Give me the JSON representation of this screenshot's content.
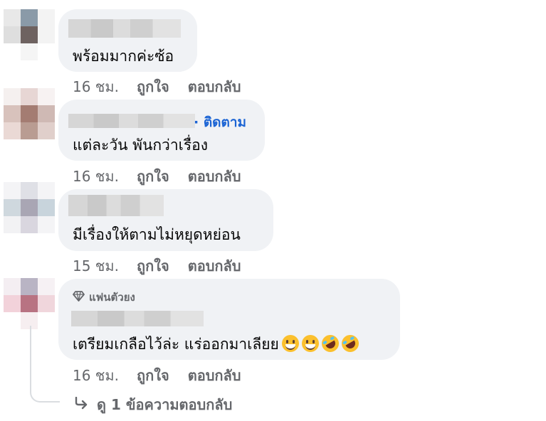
{
  "comments": [
    {
      "text": "พร้อมมากค่ะซ้อ",
      "time": "16 ชม.",
      "like_label": "ถูกใจ",
      "reply_label": "ตอบกลับ"
    },
    {
      "follow_label": "· ติดตาม",
      "text": "แต่ละวัน พันกว่าเรื่อง",
      "time": "16 ชม.",
      "like_label": "ถูกใจ",
      "reply_label": "ตอบกลับ"
    },
    {
      "text": "มีเรื่องให้ตามไม่หยุดหย่อน",
      "time": "15 ชม.",
      "like_label": "ถูกใจ",
      "reply_label": "ตอบกลับ"
    },
    {
      "badge_label": "แฟนตัวยง",
      "text": "เตรียมเกลือไว้ล่ะ แร่ออกมาเลียย",
      "time": "16 ชม.",
      "like_label": "ถูกใจ",
      "reply_label": "ตอบกลับ"
    }
  ],
  "view_replies": {
    "label": "ดู 1 ข้อความตอบกลับ"
  },
  "colors": {
    "bubble": "#f0f2f5",
    "meta_text": "#65676b",
    "follow_link": "#1b64d4"
  },
  "icons": [
    "diamond-icon",
    "reply-arrow-icon",
    "grinning-face-emoji",
    "rofl-emoji"
  ]
}
